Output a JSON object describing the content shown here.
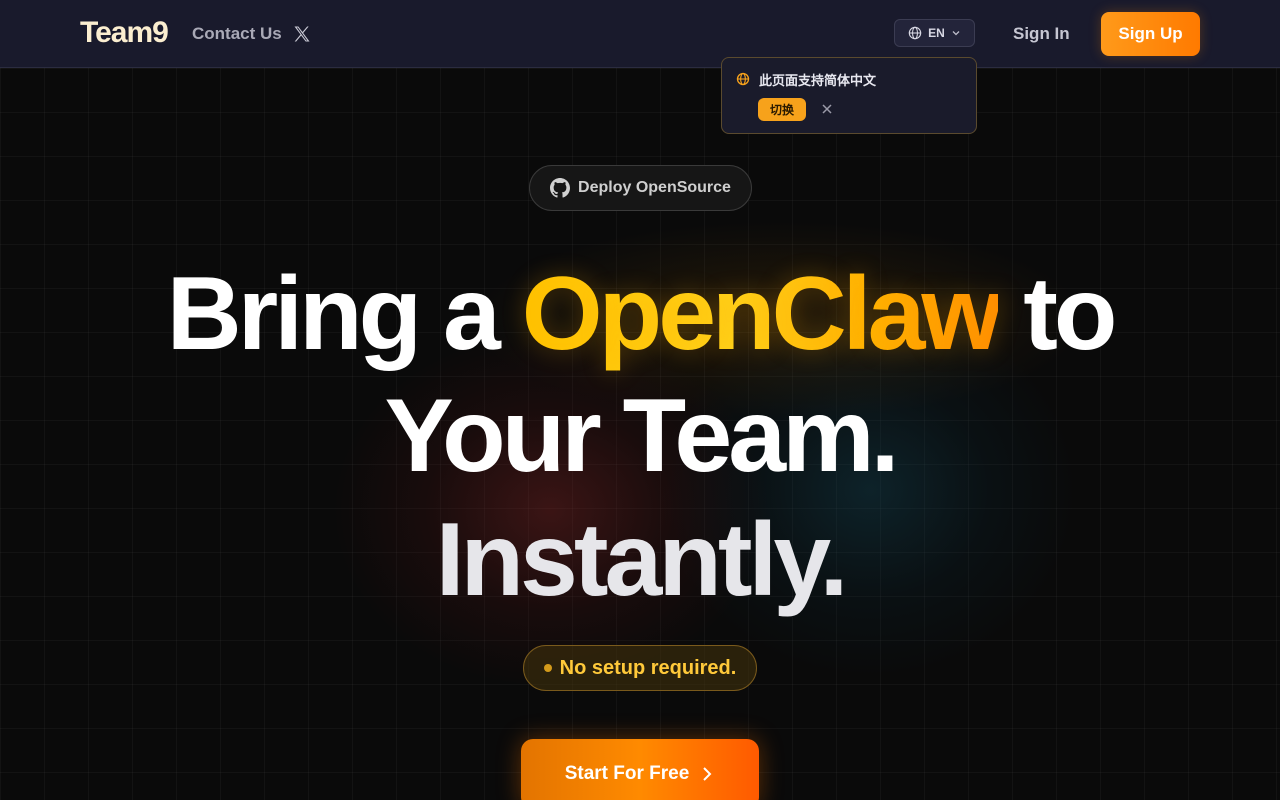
{
  "header": {
    "logo": "Team9",
    "contact_label": "Contact Us",
    "x_icon": "x-twitter-icon",
    "lang_label": "EN",
    "signin_label": "Sign In",
    "signup_label": "Sign Up"
  },
  "popover": {
    "message": "此页面支持简体中文",
    "switch_label": "切换"
  },
  "hero": {
    "deploy_label": "Deploy OpenSource",
    "line1_a": "Bring a ",
    "line1_highlight": "OpenClaw",
    "line1_b": " to",
    "line2": "Your Team.",
    "line3": "Instantly.",
    "badge_label": "No setup required.",
    "cta_label": "Start For Free"
  },
  "colors": {
    "header_bg": "#191a2c",
    "accent_orange": "#ff8a00",
    "highlight_yellow": "#ffc400",
    "page_bg": "#0a0a0a"
  }
}
